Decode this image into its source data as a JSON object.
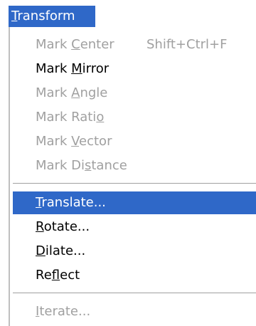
{
  "menu": {
    "title": {
      "pre": "",
      "ul": "T",
      "post": "ransform"
    },
    "group1": [
      {
        "pre": "Mark ",
        "ul": "C",
        "post": "enter",
        "shortcut": "Shift+Ctrl+F",
        "state": "disabled"
      },
      {
        "pre": "Mark ",
        "ul": "M",
        "post": "irror",
        "shortcut": "",
        "state": "enabled"
      },
      {
        "pre": "Mark ",
        "ul": "A",
        "post": "ngle",
        "shortcut": "",
        "state": "disabled"
      },
      {
        "pre": "Mark Rati",
        "ul": "o",
        "post": "",
        "shortcut": "",
        "state": "disabled"
      },
      {
        "pre": "Mark ",
        "ul": "V",
        "post": "ector",
        "shortcut": "",
        "state": "disabled"
      },
      {
        "pre": "Mark Di",
        "ul": "s",
        "post": "tance",
        "shortcut": "",
        "state": "disabled"
      }
    ],
    "group2": [
      {
        "pre": "",
        "ul": "T",
        "post": "ranslate...",
        "state": "selected"
      },
      {
        "pre": "",
        "ul": "R",
        "post": "otate...",
        "state": "enabled"
      },
      {
        "pre": "",
        "ul": "D",
        "post": "ilate...",
        "state": "enabled"
      },
      {
        "pre": "Re",
        "ul": "f",
        "post": "lect",
        "state": "enabled"
      }
    ],
    "group3": [
      {
        "pre": "",
        "ul": "I",
        "post": "terate...",
        "state": "disabled"
      }
    ]
  },
  "colors": {
    "highlight": "#2f68c8",
    "disabled_text": "#a0a0a0",
    "enabled_text": "#000000"
  }
}
